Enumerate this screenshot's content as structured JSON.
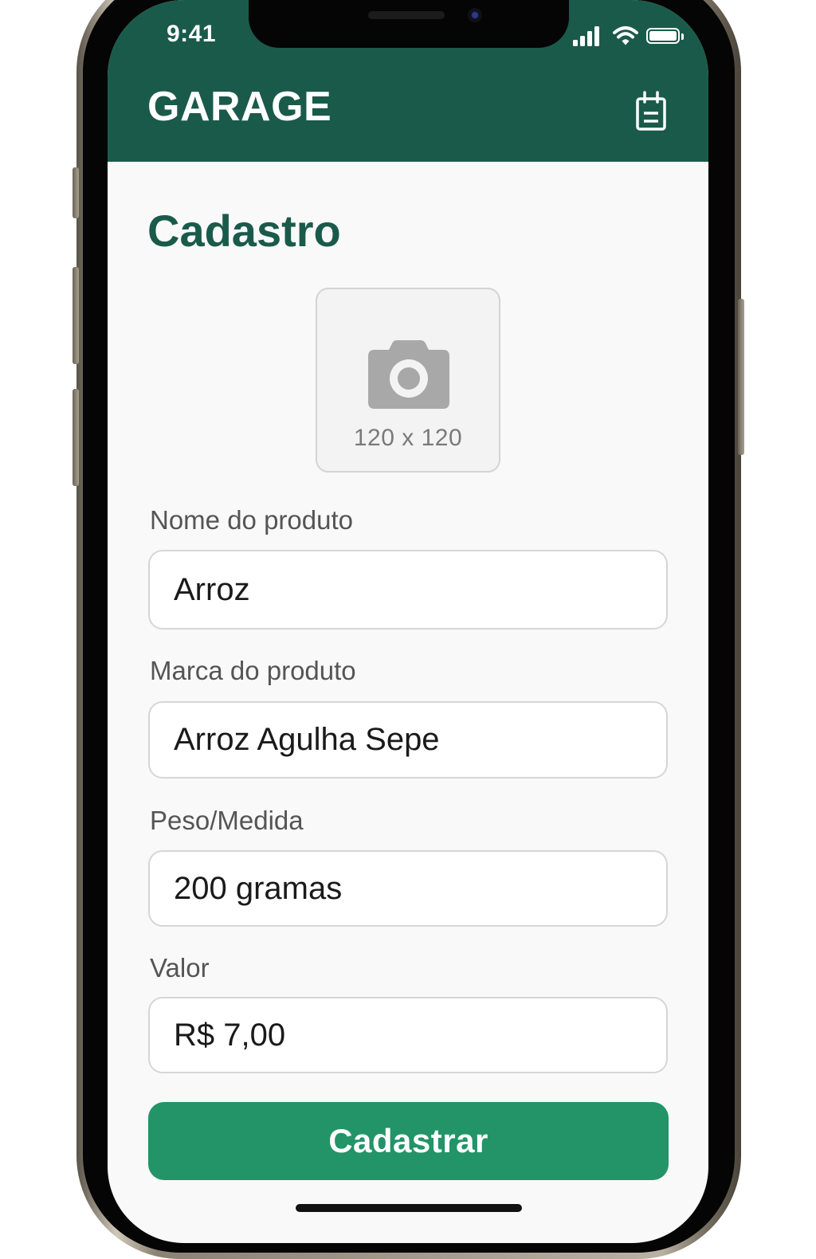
{
  "status_bar": {
    "time": "9:41"
  },
  "header": {
    "app_title": "GARAGE",
    "calendar_icon": "calendar-icon",
    "background_color": "#1a5a4b"
  },
  "page": {
    "title": "Cadastro"
  },
  "photo_picker": {
    "icon": "camera-icon",
    "size_label": "120 x 120"
  },
  "form": {
    "fields": [
      {
        "label": "Nome do produto",
        "value": "Arroz"
      },
      {
        "label": "Marca do produto",
        "value": "Arroz Agulha Sepe"
      },
      {
        "label": "Peso/Medida",
        "value": "200 gramas"
      },
      {
        "label": "Valor",
        "value": "R$ 7,00"
      }
    ],
    "submit_label": "Cadastrar",
    "submit_color": "#229468"
  }
}
